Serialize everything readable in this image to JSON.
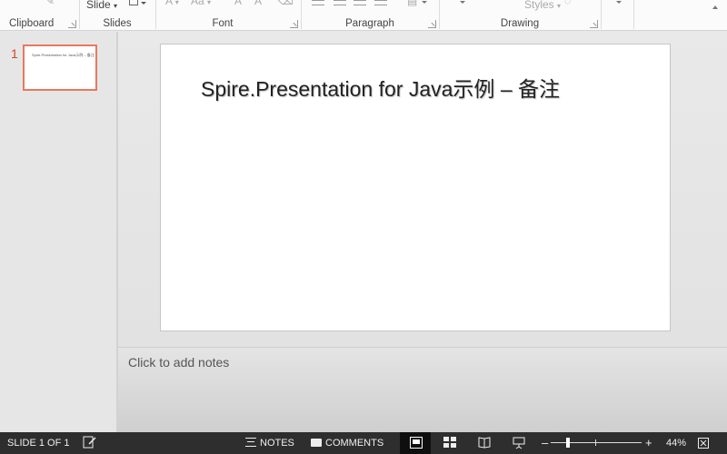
{
  "ribbon": {
    "groups": {
      "clipboard": "Clipboard",
      "slides": "Slides",
      "font": "Font",
      "paragraph": "Paragraph",
      "drawing": "Drawing"
    },
    "partial_labels": {
      "slide": "Slide",
      "styles": "Styles",
      "font_size_up": "A",
      "font_size_down": "A",
      "change_case": "Aa"
    }
  },
  "thumbnails": [
    {
      "number": "1",
      "text": "Spire.Presentation for Java示例 – 备注"
    }
  ],
  "slide": {
    "title": "Spire.Presentation for Java示例 – 备注"
  },
  "notes": {
    "placeholder": "Click to add notes"
  },
  "statusbar": {
    "slide_indicator": "SLIDE 1 OF 1",
    "notes_label": "NOTES",
    "comments_label": "COMMENTS",
    "zoom_minus": "–",
    "zoom_plus": "+",
    "zoom_level": "44%",
    "zoom_fraction": 0.44
  },
  "colors": {
    "accent": "#d24726",
    "thumb_border": "#e8785e",
    "status_bg": "#2e2e2e"
  }
}
